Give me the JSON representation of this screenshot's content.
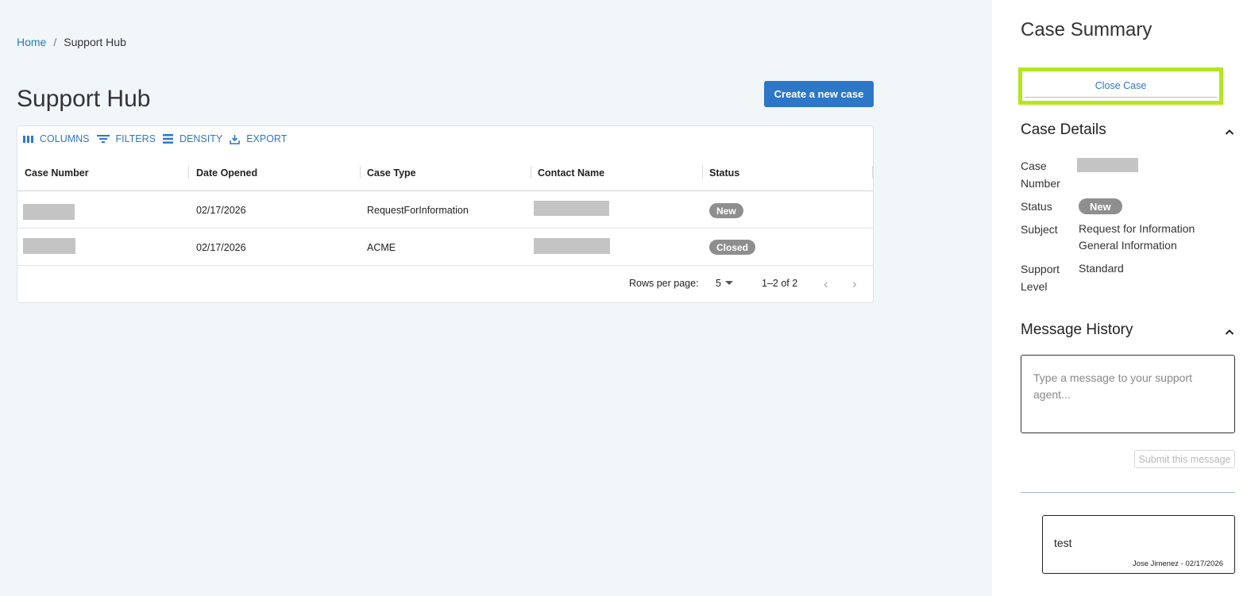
{
  "breadcrumb": {
    "home": "Home",
    "separator": "/",
    "current": "Support Hub"
  },
  "page": {
    "title": "Support Hub",
    "create_button": "Create a new case"
  },
  "toolbar": {
    "columns": "COLUMNS",
    "filters": "FILTERS",
    "density": "DENSITY",
    "export": "EXPORT"
  },
  "table": {
    "headers": [
      "Case Number",
      "Date Opened",
      "Case Type",
      "Contact Name",
      "Status"
    ],
    "rows": [
      {
        "case_number": "",
        "date_opened": "02/17/2026",
        "case_type": "RequestForInformation",
        "contact_name": "",
        "status": "New"
      },
      {
        "case_number": "",
        "date_opened": "02/17/2026",
        "case_type": "ACME",
        "contact_name": "",
        "status": "Closed"
      }
    ],
    "pagination": {
      "rows_per_page_label": "Rows per page:",
      "rows_per_page": "5",
      "range": "1–2 of 2"
    }
  },
  "side": {
    "title": "Case Summary",
    "close_button": "Close Case",
    "case_details": {
      "heading": "Case Details",
      "case_number_label_1": "Case",
      "case_number_label_2": "Number",
      "status_label": "Status",
      "status_value": "New",
      "subject_label": "Subject",
      "subject_line_1": "Request for Information",
      "subject_line_2": "General Information",
      "support_label_1": "Support",
      "support_label_2": "Level",
      "support_value": "Standard"
    },
    "message_history": {
      "heading": "Message History",
      "placeholder": "Type a message to your support agent...",
      "submit_button": "Submit this message",
      "messages": [
        {
          "text": "test",
          "meta": "Jose Jimenez - 02/17/2026"
        }
      ]
    }
  },
  "colors": {
    "accent": "#2d77c8",
    "highlight": "#b5e61d",
    "pill": "#8e8e8e",
    "background": "#f1f6f9"
  }
}
